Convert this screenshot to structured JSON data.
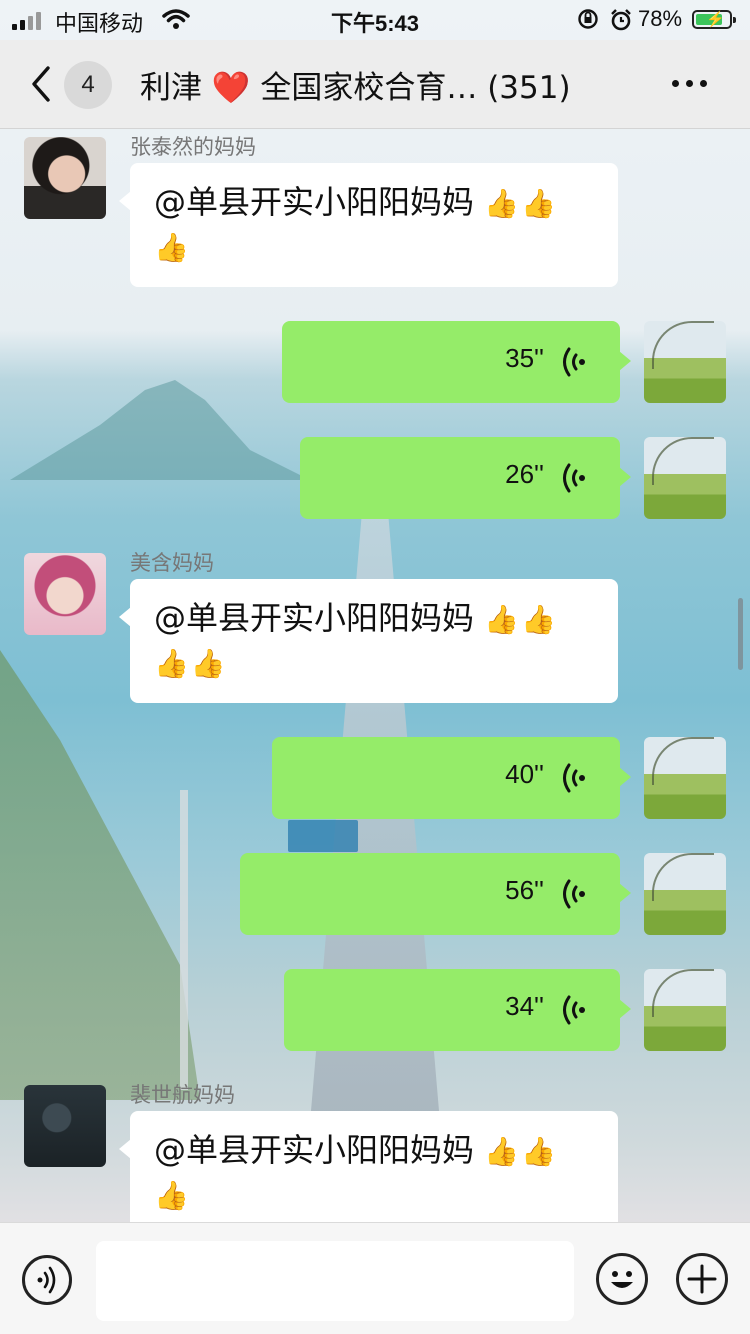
{
  "status_bar": {
    "carrier": "中国移动",
    "time": "下午5:43",
    "battery": "78%"
  },
  "nav": {
    "unread": "4",
    "title_part1": "利津",
    "title_heart": "❤️",
    "title_part2": " 全国家校合育…",
    "member_count": "(351)"
  },
  "messages": [
    {
      "sender": "张泰然的妈妈",
      "text": "@单县开实小阳阳妈妈 ",
      "thumbs_line1": "👍👍",
      "thumbs_line2": "👍"
    },
    {
      "voice": "35''"
    },
    {
      "voice": "26''"
    },
    {
      "sender": "美含妈妈",
      "text": "@单县开实小阳阳妈妈 ",
      "thumbs_line1": "👍👍",
      "thumbs_line2": "👍👍"
    },
    {
      "voice": "40''"
    },
    {
      "voice": "56''"
    },
    {
      "voice": "34''"
    },
    {
      "sender": "裴世航妈妈",
      "text": "@单县开实小阳阳妈妈 ",
      "thumbs_line1": "👍👍",
      "thumbs_line2": "👍"
    }
  ],
  "icons": {
    "back": "chevron-left-icon",
    "more": "more-dots-icon",
    "voice_message": "voice-wave-icon",
    "voice_input": "voice-input-icon",
    "emoji": "emoji-icon",
    "plus": "plus-icon"
  },
  "colors": {
    "self_bubble": "#95ec69",
    "other_bubble": "#ffffff",
    "nav_bg": "#ededed"
  }
}
